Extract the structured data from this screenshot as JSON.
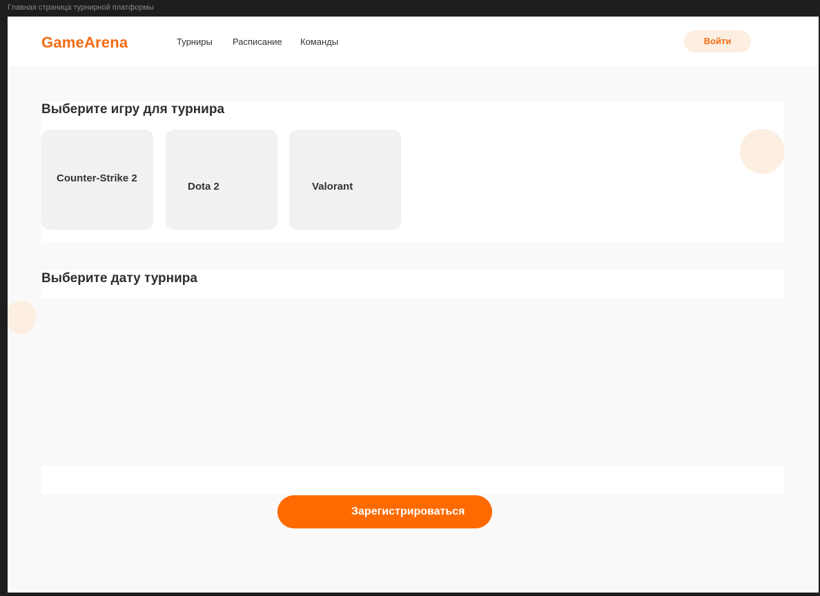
{
  "window": {
    "title": "Главная страница турнирной платформы"
  },
  "header": {
    "logo": "GameArena",
    "nav": [
      "Турниры",
      "Расписание",
      "Команды"
    ],
    "login_label": "Войти"
  },
  "games_section": {
    "title": "Выберите игру для турнира",
    "games": [
      "Counter-Strike 2",
      "Dota 2",
      "Valorant"
    ]
  },
  "date_section": {
    "title": "Выберите дату турнира"
  },
  "register_label": "Зарегистрироваться",
  "colors": {
    "accent": "#ff6a00",
    "logo": "#f36b12",
    "accent_soft": "#fdeee2",
    "page_bg": "#f9f9f9",
    "card_bg": "#f1f1f1"
  }
}
